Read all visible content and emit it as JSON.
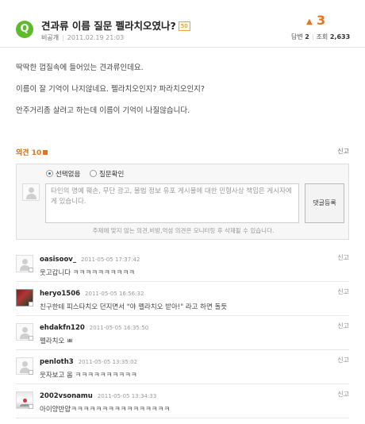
{
  "question": {
    "badge": "Q",
    "title": "견과류 이름 질문 펠라치오였나?",
    "points": "50",
    "author": "비공개",
    "date": "2011.02.19 21:03",
    "likes": "3",
    "answers_label": "답변",
    "answers": "2",
    "views_label": "조회",
    "views": "2,633"
  },
  "body": [
    "딱딱한 껍질속에 들어있는 견과류인데요.",
    "이름이 잘 기억이 나지않네요. 펠라치오인지? 파라치오인지?",
    "안주거리좀 살려고 하는데 이름이 기억이 나질않습니다."
  ],
  "comments_header": {
    "label": "의견",
    "count": "10",
    "report": "신고"
  },
  "comment_form": {
    "option_1": "선택없음",
    "option_2": "질문확인",
    "placeholder_line1": "타인의 명예 훼손, 무단 광고, 불법 정보 유포 게시물에 대한 민형사상 책임은 게시자에",
    "placeholder_line2": "게 있습니다.",
    "submit_label": "댓글등록",
    "notice": "주제에 맞지 않는 의견,비방,억성 의견은 모니터링 후 삭제될 수 있습니다."
  },
  "comments": [
    {
      "user": "oasisoov_",
      "time": "2011-05-05 17:37:42",
      "text": "웃고갑니다 ㅋㅋㅋㅋㅋㅋㅋㅋㅋㅋ",
      "report": "신고"
    },
    {
      "user": "heryo1506",
      "time": "2011-05-05 16:56:32",
      "text": "친구한테 피스타치오 던지면서 \"야 펠라치오 받아!\" 라고 하면 돌듯",
      "report": "신고"
    },
    {
      "user": "ehdakfn120",
      "time": "2011-05-05 16:35:50",
      "text": "펠라치오 ㅃ",
      "report": "신고"
    },
    {
      "user": "penloth3",
      "time": "2011-05-05 13:35:02",
      "text": "웃자보고 옴 ㅋㅋㅋㅋㅋㅋㅋㅋㅋㅋ",
      "report": "신고"
    },
    {
      "user": "2002vsonamu",
      "time": "2011-05-05 13:34:33",
      "text": "아이양반얍ㅋㅋㅋㅋㅋㅋㅋㅋㅋㅋㅋㅋㅋㅋㅋㅋ",
      "report": "신고"
    }
  ]
}
